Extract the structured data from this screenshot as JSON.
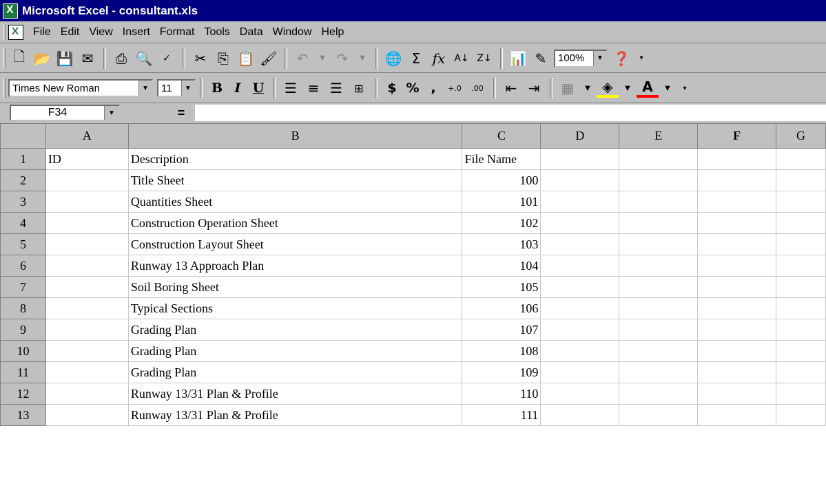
{
  "window": {
    "title": "Microsoft Excel - consultant.xls"
  },
  "menu": {
    "items": [
      "File",
      "Edit",
      "View",
      "Insert",
      "Format",
      "Tools",
      "Data",
      "Window",
      "Help"
    ]
  },
  "toolbar": {
    "zoom": "100%",
    "icons": [
      "new-icon",
      "open-icon",
      "save-icon",
      "email-icon",
      "print-icon",
      "print-preview-icon",
      "spelling-icon",
      "cut-icon",
      "copy-icon",
      "paste-icon",
      "format-painter-icon",
      "undo-icon",
      "redo-icon",
      "hyperlink-icon",
      "autosum-icon",
      "function-icon",
      "sort-ascending-icon",
      "sort-descending-icon",
      "chart-wizard-icon",
      "drawing-icon",
      "help-icon"
    ]
  },
  "formatting": {
    "font": "Times New Roman",
    "size": "11",
    "bold_label": "B",
    "italic_label": "I",
    "underline_label": "U",
    "currency_label": "$",
    "percent_label": "%",
    "comma_label": ","
  },
  "formula_bar": {
    "cell_ref": "F34",
    "equals": "=",
    "value": ""
  },
  "sheet": {
    "columns": [
      "A",
      "B",
      "C",
      "D",
      "E",
      "F",
      "G"
    ],
    "active_column": "F",
    "rows": [
      {
        "n": "1",
        "A": "ID",
        "B": "Description",
        "C": "File Name"
      },
      {
        "n": "2",
        "A": "",
        "B": "Title Sheet",
        "C": "100"
      },
      {
        "n": "3",
        "A": "",
        "B": "Quantities Sheet",
        "C": "101"
      },
      {
        "n": "4",
        "A": "",
        "B": "Construction Operation Sheet",
        "C": "102"
      },
      {
        "n": "5",
        "A": "",
        "B": "Construction Layout Sheet",
        "C": "103"
      },
      {
        "n": "6",
        "A": "",
        "B": "Runway 13 Approach Plan",
        "C": "104"
      },
      {
        "n": "7",
        "A": "",
        "B": "Soil Boring Sheet",
        "C": "105"
      },
      {
        "n": "8",
        "A": "",
        "B": "Typical Sections",
        "C": "106"
      },
      {
        "n": "9",
        "A": "",
        "B": "Grading Plan",
        "C": "107"
      },
      {
        "n": "10",
        "A": "",
        "B": "Grading Plan",
        "C": "108"
      },
      {
        "n": "11",
        "A": "",
        "B": "Grading Plan",
        "C": "109"
      },
      {
        "n": "12",
        "A": "",
        "B": "Runway 13/31 Plan & Profile",
        "C": "110"
      },
      {
        "n": "13",
        "A": "",
        "B": "Runway 13/31 Plan & Profile",
        "C": "111"
      }
    ]
  }
}
